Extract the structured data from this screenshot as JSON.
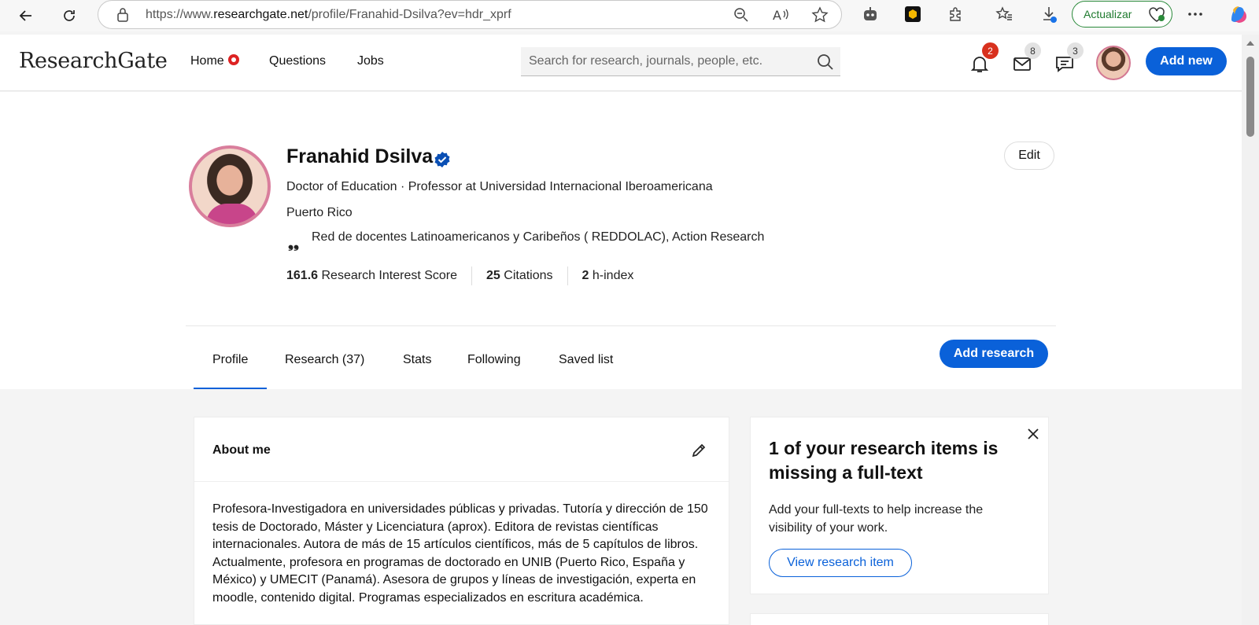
{
  "browser": {
    "url_prefix": "https://www.",
    "url_domain": "researchgate.net",
    "url_path": "/profile/Franahid-Dsilva?ev=hdr_xprf",
    "update_label": "Actualizar"
  },
  "header": {
    "logo": "ResearchGate",
    "nav": [
      "Home",
      "Questions",
      "Jobs"
    ],
    "search_placeholder": "Search for research, journals, people, etc.",
    "notifications_count": "2",
    "messages_count": "8",
    "chat_count": "3",
    "add_new_label": "Add new"
  },
  "profile": {
    "name": "Franahid Dsilva",
    "headline": "Doctor of Education · Professor at Universidad Internacional Iberoamericana",
    "location": "Puerto Rico",
    "quote_mark": "❟❟",
    "interests": "Red de docentes Latinoamericanos y Caribeños ( REDDOLAC), Action Research",
    "edit_label": "Edit",
    "stats": [
      {
        "value": "161.6",
        "label": "Research Interest Score"
      },
      {
        "value": "25",
        "label": "Citations"
      },
      {
        "value": "2",
        "label": "h-index"
      }
    ]
  },
  "tabs": [
    "Profile",
    "Research (37)",
    "Stats",
    "Following",
    "Saved list"
  ],
  "add_research_label": "Add research",
  "about": {
    "title": "About me",
    "text": "Profesora-Investigadora en universidades públicas y privadas. Tutoría y dirección de 150 tesis de Doctorado, Máster y Licenciatura (aprox). Editora de revistas científicas internacionales. Autora de más de 15 artículos científicos, más de 5 capítulos de libros. Actualmente, profesora en programas de doctorado en UNIB (Puerto Rico, España y México) y UMECIT (Panamá). Asesora de grupos y líneas de investigación, experta en moodle, contenido digital. Programas especializados en escritura académica."
  },
  "fulltext_card": {
    "title": "1 of your research items is missing a full-text",
    "text": "Add your full-texts to help increase the visibility of your work.",
    "button": "View research item"
  },
  "colors": {
    "brand_blue": "#0a61d9",
    "badge_red": "#d8311e",
    "update_green": "#1e7a2e"
  }
}
